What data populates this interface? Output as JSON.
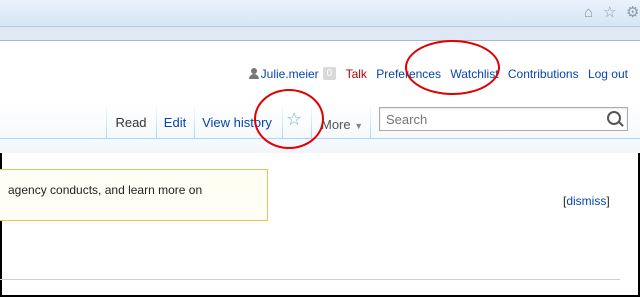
{
  "browser": {
    "toolbar_icons": [
      "home-icon",
      "star-outline-icon"
    ]
  },
  "personal_tools": {
    "username": "Julie.meier",
    "notification_count": "0",
    "links": [
      "Talk",
      "Preferences",
      "Watchlist",
      "Contributions",
      "Log out"
    ]
  },
  "tabs": {
    "read": "Read",
    "edit": "Edit",
    "view_history": "View history",
    "more": "More"
  },
  "search": {
    "placeholder": "Search"
  },
  "banner": {
    "text": "agency conducts, and learn more on"
  },
  "dismiss": {
    "label": "dismiss"
  },
  "colors": {
    "link": "#0645ad",
    "link_red": "#ba0000",
    "annotation": "#e00000",
    "banner_border": "#f0c060"
  }
}
